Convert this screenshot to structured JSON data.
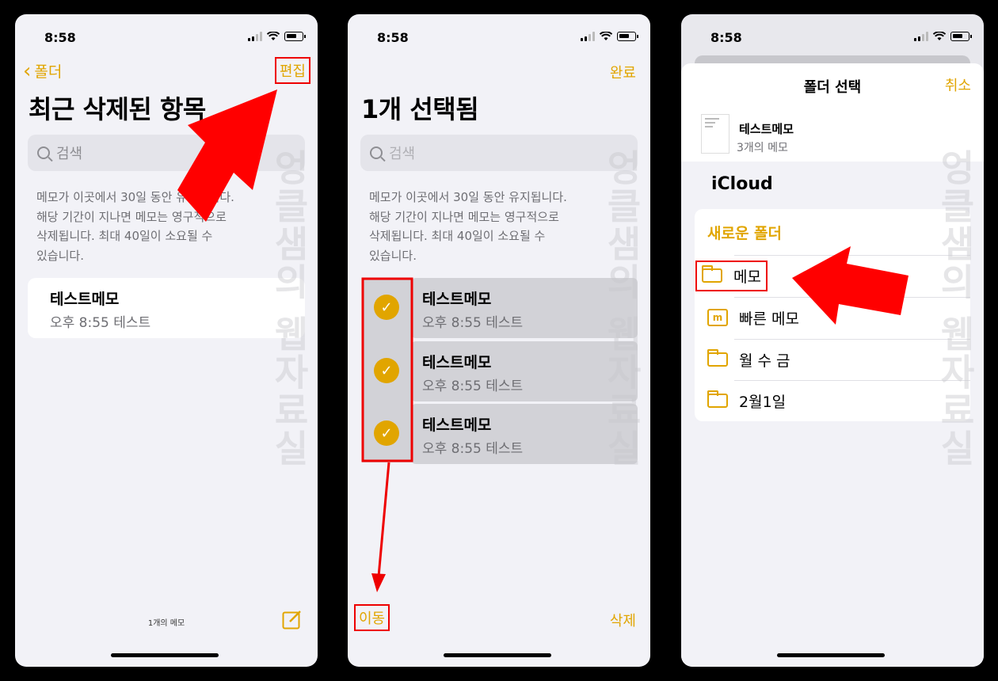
{
  "status": {
    "time": "8:58"
  },
  "watermark": "엉클샘의 웹자료실",
  "screen1": {
    "back": "폴더",
    "edit": "편집",
    "title": "최근 삭제된 항목",
    "search_placeholder": "검색",
    "info": [
      "메모가 이곳에서 30일 동안 유지됩니다.",
      "해당 기간이 지나면 메모는 영구적으로",
      "삭제됩니다. 최대 40일이 소요될 수",
      "있습니다."
    ],
    "note": {
      "title": "테스트메모",
      "subtitle": "오후 8:55  테스트"
    },
    "count": "1개의 메모",
    "compose_icon": "compose-icon"
  },
  "screen2": {
    "done": "완료",
    "title": "1개 선택됨",
    "search_placeholder": "검색",
    "info": [
      "메모가 이곳에서 30일 동안 유지됩니다.",
      "해당 기간이 지나면 메모는 영구적으로",
      "삭제됩니다. 최대 40일이 소요될 수",
      "있습니다."
    ],
    "notes": [
      {
        "title": "테스트메모",
        "subtitle": "오후 8:55  테스트"
      },
      {
        "title": "테스트메모",
        "subtitle": "오후 8:55  테스트"
      },
      {
        "title": "테스트메모",
        "subtitle": "오후 8:55  테스트"
      }
    ],
    "move": "이동",
    "delete": "삭제"
  },
  "screen3": {
    "sheet_title": "폴더 선택",
    "cancel": "취소",
    "note_name": "테스트메모",
    "note_count": "3개의 메모",
    "account": "iCloud",
    "new_folder": "새로운 폴더",
    "folders": [
      "메모",
      "빠른 메모",
      "월 수 금",
      "2월1일"
    ]
  },
  "colors": {
    "accent": "#e1a500",
    "highlight": "#ee0000"
  }
}
